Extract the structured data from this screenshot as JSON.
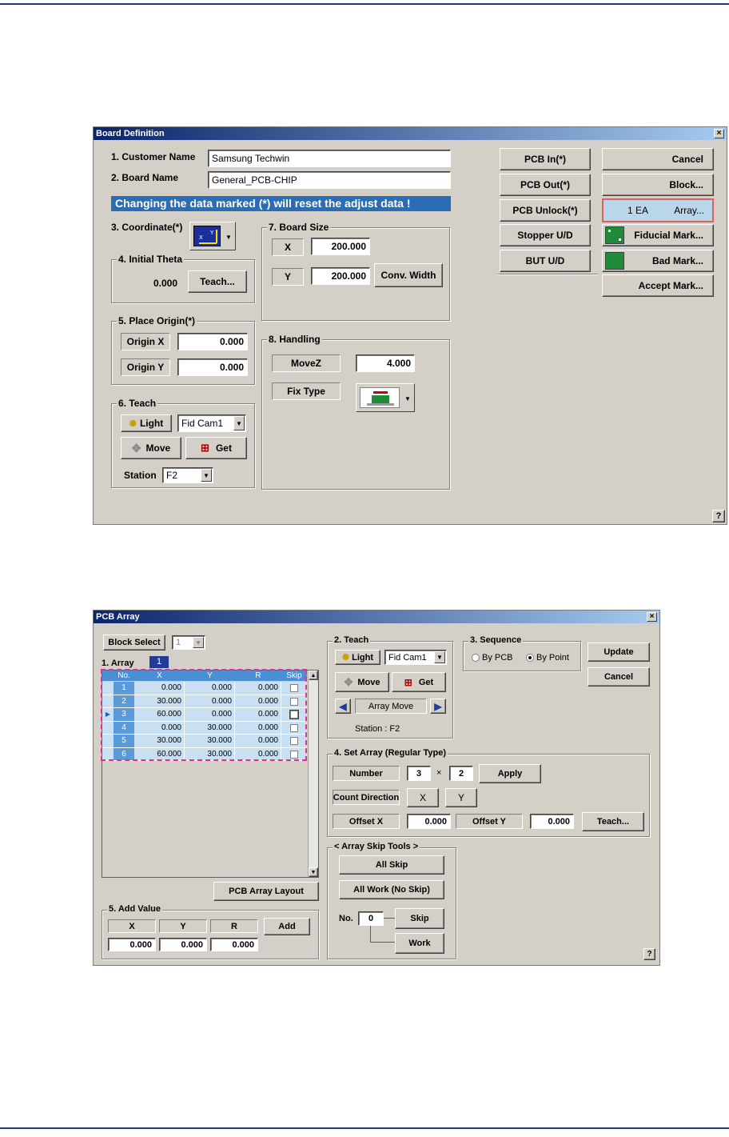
{
  "board": {
    "title": "Board Definition",
    "close": "×",
    "customer_label": "1. Customer Name",
    "customer_value": "Samsung Techwin",
    "board_label": "2. Board Name",
    "board_value": "General_PCB-CHIP",
    "warning": "Changing the data marked (*) will reset the adjust data !",
    "coordinate_label": "3. Coordinate(*)",
    "theta": {
      "title": "4. Initial Theta",
      "value": "0.000",
      "teach": "Teach..."
    },
    "origin": {
      "title": "5. Place Origin(*)",
      "x_label": "Origin X",
      "x_value": "0.000",
      "y_label": "Origin Y",
      "y_value": "0.000"
    },
    "teach": {
      "title": "6. Teach",
      "light": "Light",
      "camera": "Fid Cam1",
      "move": "Move",
      "get": "Get",
      "station_label": "Station",
      "station_value": "F2"
    },
    "size": {
      "title": "7. Board Size",
      "x_label": "X",
      "x_value": "200.000",
      "y_label": "Y",
      "y_value": "200.000",
      "conv": "Conv. Width"
    },
    "handling": {
      "title": "8. Handling",
      "movez_label": "MoveZ",
      "movez_value": "4.000",
      "fix_label": "Fix Type"
    },
    "buttons": {
      "pcb_in": "PCB In(*)",
      "pcb_out": "PCB Out(*)",
      "pcb_unlock": "PCB Unlock(*)",
      "stopper": "Stopper U/D",
      "but": "BUT U/D",
      "cancel": "Cancel",
      "block": "Block...",
      "array_count": "1 EA",
      "array": "Array...",
      "fiducial": "Fiducial Mark...",
      "bad": "Bad Mark...",
      "accept": "Accept Mark..."
    },
    "help": "?"
  },
  "pcb_array": {
    "title": "PCB Array",
    "close": "×",
    "block_select_label": "Block Select",
    "block_select_value": "1",
    "array_label": "1. Array",
    "array_index": "1",
    "table": {
      "headers": [
        "No.",
        "X",
        "Y",
        "R",
        "Skip"
      ],
      "rows": [
        [
          "1",
          "0.000",
          "0.000",
          "0.000"
        ],
        [
          "2",
          "30.000",
          "0.000",
          "0.000"
        ],
        [
          "3",
          "60.000",
          "0.000",
          "0.000"
        ],
        [
          "4",
          "0.000",
          "30.000",
          "0.000"
        ],
        [
          "5",
          "30.000",
          "30.000",
          "0.000"
        ],
        [
          "6",
          "60.000",
          "30.000",
          "0.000"
        ]
      ]
    },
    "layout_button": "PCB Array Layout",
    "add": {
      "title": "5. Add Value",
      "x_label": "X",
      "y_label": "Y",
      "r_label": "R",
      "x_value": "0.000",
      "y_value": "0.000",
      "r_value": "0.000",
      "button": "Add"
    },
    "teach": {
      "title": "2. Teach",
      "light": "Light",
      "camera": "Fid Cam1",
      "move": "Move",
      "get": "Get",
      "array_move": "Array Move",
      "station": "Station :  F2"
    },
    "sequence": {
      "title": "3. Sequence",
      "by_pcb": "By PCB",
      "by_point": "By Point"
    },
    "update": "Update",
    "cancel": "Cancel",
    "set_array": {
      "title": "4. Set Array (Regular Type)",
      "number_label": "Number",
      "num_x": "3",
      "times": "×",
      "num_y": "2",
      "apply": "Apply",
      "count_label": "Count Direction",
      "count_x": "X",
      "count_y": "Y",
      "offset_x_label": "Offset X",
      "offset_x": "0.000",
      "offset_y_label": "Offset Y",
      "offset_y": "0.000",
      "teach": "Teach..."
    },
    "skip_tools": {
      "title": "< Array Skip Tools >",
      "all_skip": "All Skip",
      "all_work": "All Work (No Skip)",
      "no_label": "No.",
      "no_value": "0",
      "skip": "Skip",
      "work": "Work"
    },
    "help": "?"
  }
}
